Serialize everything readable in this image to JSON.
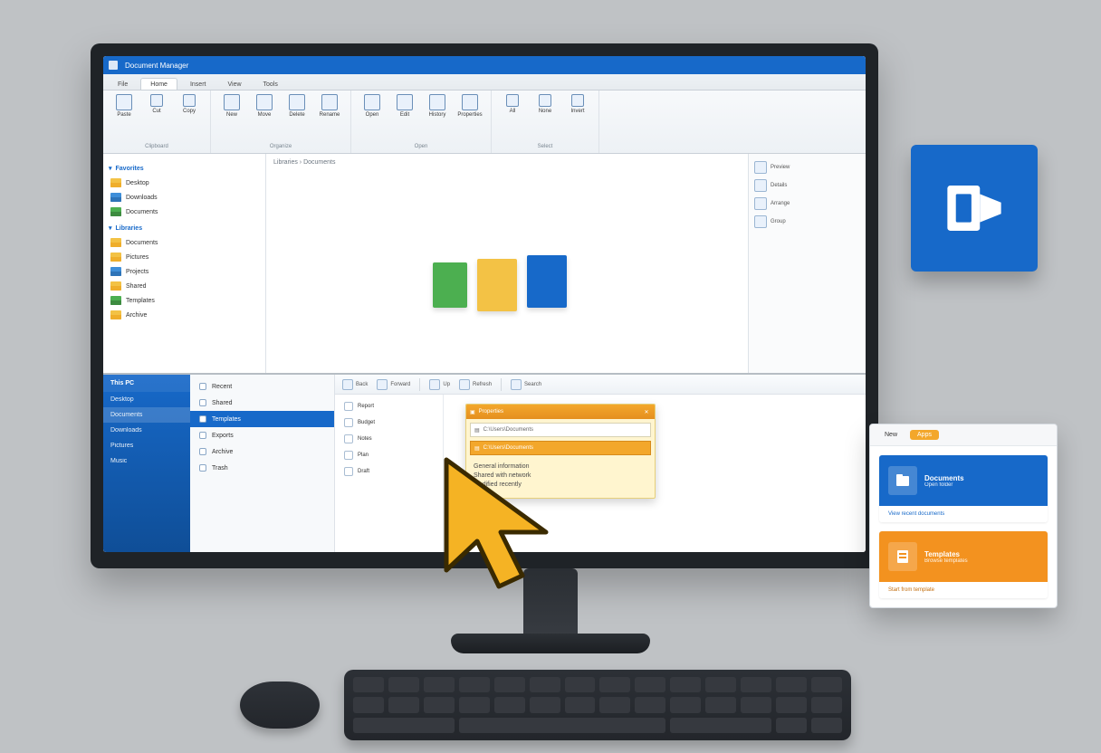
{
  "title_bar": {
    "title": "Document Manager"
  },
  "ribbon_tabs": [
    "File",
    "Home",
    "Insert",
    "View",
    "Tools"
  ],
  "ribbon_groups": [
    {
      "label": "Clipboard",
      "cmds": [
        "Paste",
        "Cut",
        "Copy"
      ]
    },
    {
      "label": "Organize",
      "cmds": [
        "New",
        "Move",
        "Delete",
        "Rename"
      ]
    },
    {
      "label": "Open",
      "cmds": [
        "Open",
        "Edit",
        "History",
        "Properties"
      ]
    },
    {
      "label": "Select",
      "cmds": [
        "All",
        "None",
        "Invert"
      ]
    }
  ],
  "nav": {
    "section1": {
      "label": "Favorites",
      "items": [
        "Desktop",
        "Downloads",
        "Documents"
      ]
    },
    "section2": {
      "label": "Libraries",
      "items": [
        "Documents",
        "Pictures",
        "Projects",
        "Shared",
        "Templates",
        "Archive"
      ]
    }
  },
  "content": {
    "breadcrumb": "Libraries › Documents"
  },
  "side_tools": {
    "items": [
      "Preview",
      "Details",
      "Arrange",
      "Group"
    ]
  },
  "explorer": {
    "side_header": "This PC",
    "side_items": [
      "Desktop",
      "Documents",
      "Downloads",
      "Pictures",
      "Music"
    ],
    "mid_items": [
      "Recent",
      "Shared",
      "Templates",
      "Exports",
      "Archive",
      "Trash"
    ],
    "mid_selected_index": 2,
    "toolbar": [
      "Back",
      "Forward",
      "Up",
      "Refresh",
      "Search"
    ],
    "list_items": [
      "Report",
      "Budget",
      "Notes",
      "Plan",
      "Draft"
    ]
  },
  "note": {
    "title": "Properties",
    "path": "C:\\Users\\Documents",
    "lines": [
      "General information",
      "Shared with network",
      "Modified recently"
    ]
  },
  "float_panel": {
    "tabs": [
      "New",
      "Apps"
    ],
    "card1": {
      "title": "Documents",
      "subtitle": "Open folder",
      "caption": "View recent documents"
    },
    "card2": {
      "title": "Templates",
      "subtitle": "Browse templates",
      "caption": "Start from template"
    }
  }
}
